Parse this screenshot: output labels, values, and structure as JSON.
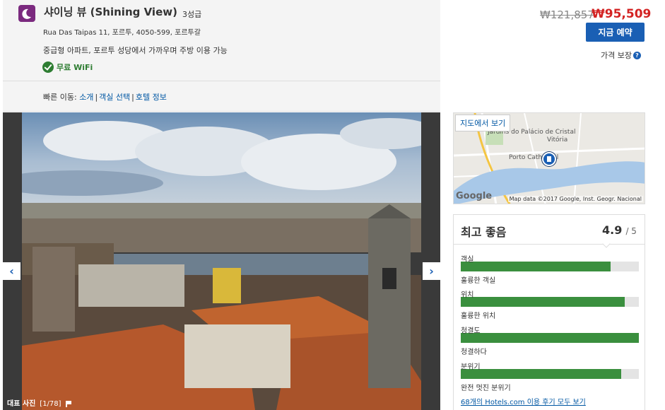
{
  "hotel": {
    "name": "샤이닝 뷰 (Shining View)",
    "stars": "3성급",
    "address": "Rua Das Taipas 11, 포르투, 4050-599, 포르투갈",
    "description": "중급형 아파트, 포르투 성당에서 가까우며 주방 이용 가능",
    "amenity": "무료 WiFi"
  },
  "quicknav": {
    "label": "빠른 이동:",
    "links": [
      "소개",
      "객실 선택",
      "호텔 정보"
    ]
  },
  "price": {
    "old": "₩121,857",
    "new": "₩95,509",
    "book_label": "지금 예약",
    "guarantee": "가격 보장",
    "guarantee_icon": "?"
  },
  "gallery": {
    "caption": "대표 사진",
    "count": "[1/78]",
    "prev_icon": "‹",
    "next_icon": "›"
  },
  "map": {
    "button": "지도에서 보기",
    "credit": "Map data ©2017 Google, Inst. Geogr. Nacional",
    "google": "Google",
    "labels": [
      "Jardins do Palácio de Cristal",
      "Vitória",
      "Porto Cathedral"
    ]
  },
  "ratings": {
    "title": "최고 좋음",
    "score": "4.9",
    "out_of": "/ 5",
    "categories": [
      {
        "label": "객실",
        "sub": "훌륭한 객실",
        "value": 0.84
      },
      {
        "label": "위치",
        "sub": "훌륭한 위치",
        "value": 0.92
      },
      {
        "label": "청결도",
        "sub": "청결하다",
        "value": 1.0
      },
      {
        "label": "분위기",
        "sub": "완전 멋진 분위기",
        "value": 0.9
      }
    ],
    "reviews_link": "68개의 Hotels.com 이용 후기 모두 보기"
  },
  "colors": {
    "brand": "#7b2a7f",
    "accent": "#1a5fb4",
    "price_red": "#d32323",
    "rating_green": "#3a8f3e"
  }
}
